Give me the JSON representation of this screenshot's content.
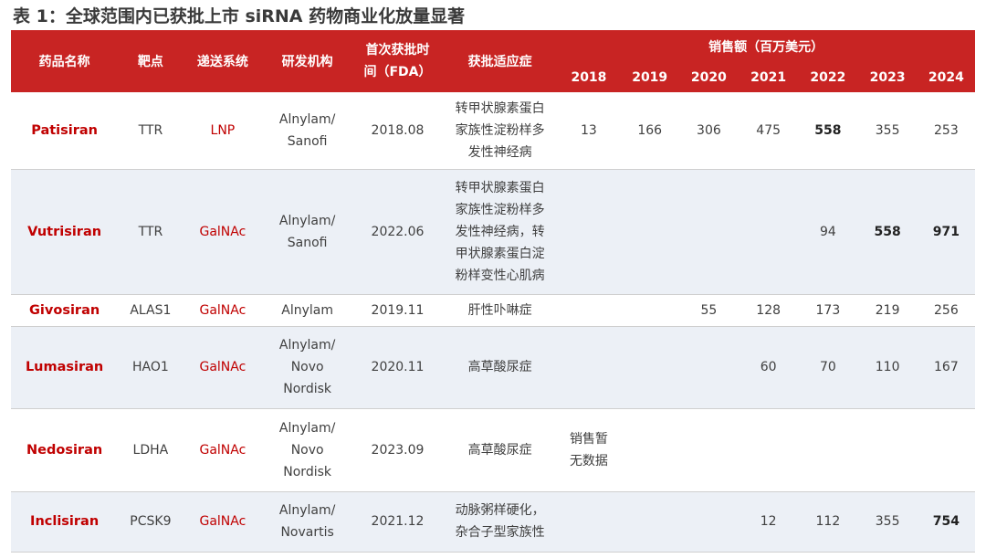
{
  "title": "表 1：全球范围内已获批上市 siRNA 药物商业化放量显著",
  "columns": {
    "drug": "药品名称",
    "target": "靶点",
    "delivery": "递送系统",
    "developer": "研发机构",
    "approval_date": "首次获批时间（FDA）",
    "indication": "获批适应症",
    "sales_group": "销售额（百万美元）",
    "years": [
      "2018",
      "2019",
      "2020",
      "2021",
      "2022",
      "2023",
      "2024"
    ]
  },
  "rows": [
    {
      "drug": "Patisiran",
      "target": "TTR",
      "delivery": "LNP",
      "developer": [
        "Alnylam/",
        "Sanofi"
      ],
      "approval_date": "2018.08",
      "indication": [
        "转甲状腺素蛋白",
        "家族性淀粉样多",
        "发性神经病"
      ],
      "sales": [
        "13",
        "166",
        "306",
        "475",
        "558",
        "355",
        "253"
      ]
    },
    {
      "drug": "Vutrisiran",
      "target": "TTR",
      "delivery": "GalNAc",
      "developer": [
        "Alnylam/",
        "Sanofi"
      ],
      "approval_date": "2022.06",
      "indication": [
        "转甲状腺素蛋白",
        "家族性淀粉样多",
        "发性神经病，转",
        "甲状腺素蛋白淀",
        "粉样变性心肌病"
      ],
      "sales": [
        "",
        "",
        "",
        "",
        "94",
        "558",
        "971"
      ]
    },
    {
      "drug": "Givosiran",
      "target": "ALAS1",
      "delivery": "GalNAc",
      "developer": [
        "Alnylam"
      ],
      "approval_date": "2019.11",
      "indication": [
        "肝性卟啉症"
      ],
      "sales": [
        "",
        "",
        "55",
        "128",
        "173",
        "219",
        "256"
      ]
    },
    {
      "drug": "Lumasiran",
      "target": "HAO1",
      "delivery": "GalNAc",
      "developer": [
        "Alnylam/",
        "Novo",
        "Nordisk"
      ],
      "approval_date": "2020.11",
      "indication": [
        "高草酸尿症"
      ],
      "sales": [
        "",
        "",
        "",
        "60",
        "70",
        "110",
        "167"
      ]
    },
    {
      "drug": "Nedosiran",
      "target": "LDHA",
      "delivery": "GalNAc",
      "developer": [
        "Alnylam/",
        "Novo",
        "Nordisk"
      ],
      "approval_date": "2023.09",
      "indication": [
        "高草酸尿症"
      ],
      "sales_note": [
        "销售暂",
        "无数据"
      ],
      "sales": [
        "",
        "",
        "",
        "",
        "",
        "",
        ""
      ]
    },
    {
      "drug": "Inclisiran",
      "target": "PCSK9",
      "delivery": "GalNAc",
      "developer": [
        "Alnylam/",
        "Novartis"
      ],
      "approval_date": "2021.12",
      "indication": [
        "动脉粥样硬化，",
        "杂合子型家族性"
      ],
      "sales": [
        "",
        "",
        "",
        "12",
        "112",
        "355",
        "754"
      ]
    }
  ],
  "bold_cells": [
    [
      0,
      4
    ],
    [
      1,
      5
    ],
    [
      1,
      6
    ],
    [
      5,
      6
    ]
  ],
  "colors": {
    "header_bg": "#c82423",
    "header_text": "#ffffff",
    "drug_text": "#c00000",
    "stripe": "#ecf0f6"
  }
}
